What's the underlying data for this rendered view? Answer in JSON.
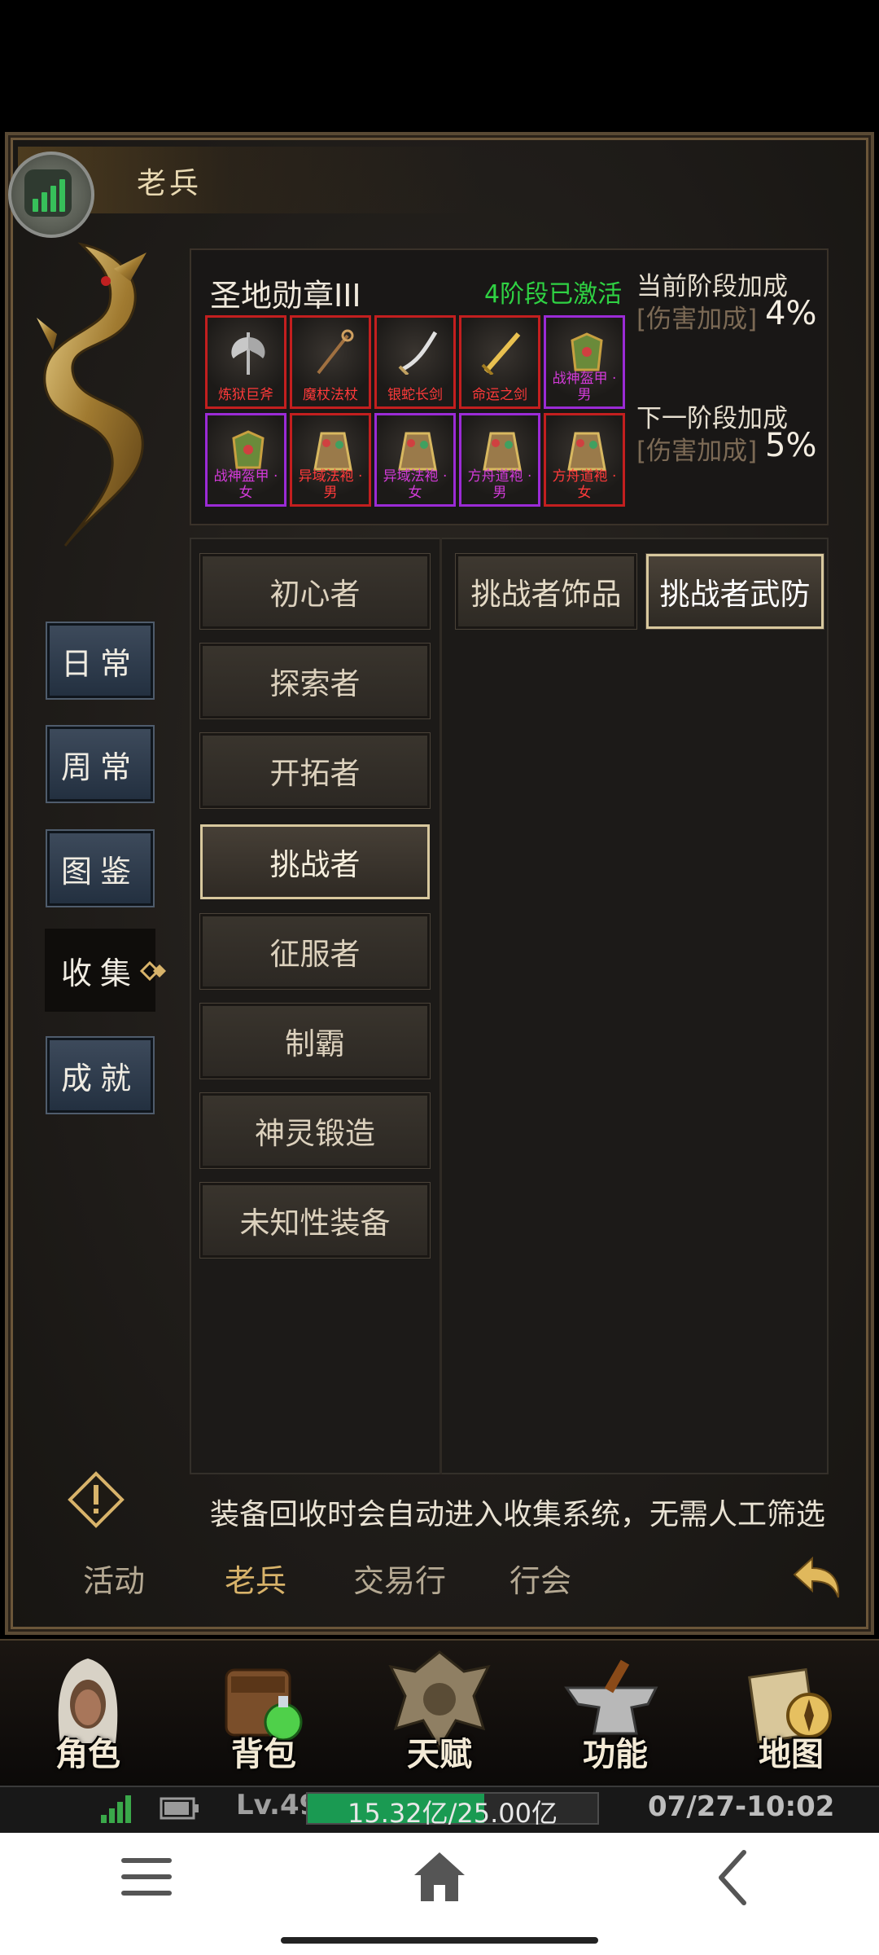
{
  "window": {
    "title": "老兵"
  },
  "medal": {
    "name": "圣地勋章III",
    "status": "4阶段已激活",
    "items_row1": [
      {
        "label": "炼狱巨斧",
        "rarity": "red",
        "icon": "axe-icon"
      },
      {
        "label": "魔杖法杖",
        "rarity": "red",
        "icon": "staff-icon"
      },
      {
        "label": "银蛇长剑",
        "rarity": "red",
        "icon": "curved-sword-icon"
      },
      {
        "label": "命运之剑",
        "rarity": "red",
        "icon": "gold-sword-icon"
      },
      {
        "label": "战神盔甲 · 男",
        "rarity": "purple",
        "icon": "armor-icon"
      }
    ],
    "items_row2": [
      {
        "label": "战神盔甲 · 女",
        "rarity": "purple",
        "icon": "armor-icon"
      },
      {
        "label": "异域法袍 · 男",
        "rarity": "red",
        "icon": "robe-icon"
      },
      {
        "label": "异域法袍 · 女",
        "rarity": "purple",
        "icon": "robe-icon"
      },
      {
        "label": "方舟道袍 · 男",
        "rarity": "purple",
        "icon": "robe-icon"
      },
      {
        "label": "方舟道袍 · 女",
        "rarity": "red",
        "icon": "robe-icon"
      }
    ],
    "current_bonus": {
      "title": "当前阶段加成",
      "type": "[伤害加成]",
      "value": "4%"
    },
    "next_bonus": {
      "title": "下一阶段加成",
      "type": "[伤害加成]",
      "value": "5%"
    }
  },
  "side_menu": [
    {
      "label": "日常",
      "active": false
    },
    {
      "label": "周常",
      "active": false
    },
    {
      "label": "图鉴",
      "active": false
    },
    {
      "label": "收集",
      "active": true
    },
    {
      "label": "成就",
      "active": false
    }
  ],
  "tiers": [
    {
      "label": "初心者",
      "active": false
    },
    {
      "label": "探索者",
      "active": false
    },
    {
      "label": "开拓者",
      "active": false
    },
    {
      "label": "挑战者",
      "active": true
    },
    {
      "label": "征服者",
      "active": false
    },
    {
      "label": "制霸",
      "active": false
    },
    {
      "label": "神灵锻造",
      "active": false
    },
    {
      "label": "未知性装备",
      "active": false
    }
  ],
  "sub_tabs": [
    {
      "label": "挑战者饰品",
      "active": false
    },
    {
      "label": "挑战者武防",
      "active": true
    }
  ],
  "hint": "装备回收时会自动进入收集系统，无需人工筛选",
  "bottom_tabs": [
    {
      "label": "活动",
      "active": false
    },
    {
      "label": "老兵",
      "active": true
    },
    {
      "label": "交易行",
      "active": false
    },
    {
      "label": "行会",
      "active": false
    }
  ],
  "dock": [
    {
      "label": "角色",
      "icon": "hooded-character-icon"
    },
    {
      "label": "背包",
      "icon": "backpack-icon"
    },
    {
      "label": "天赋",
      "icon": "dragon-crest-icon"
    },
    {
      "label": "功能",
      "icon": "anvil-icon"
    },
    {
      "label": "地图",
      "icon": "map-compass-icon"
    }
  ],
  "status": {
    "level": "Lv.49",
    "exp_text": "15.32亿/25.00亿",
    "exp_fraction": 0.61,
    "datetime": "07/27-10:02"
  },
  "colors": {
    "accent_gold": "#d8b36a",
    "exp_green": "#1a9a52",
    "rarity_red": "#c31f1f",
    "rarity_purple": "#9b2bd6",
    "status_green": "#2fd243"
  }
}
